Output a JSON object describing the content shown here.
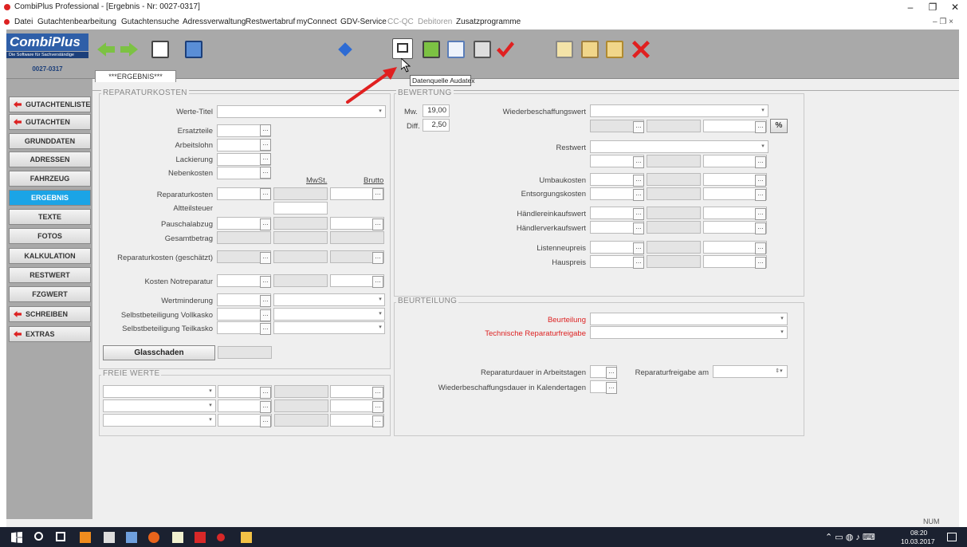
{
  "window": {
    "title": "CombiPlus Professional - [Ergebnis - Nr: 0027-0317]"
  },
  "menu": [
    "Datei",
    "Gutachtenbearbeitung",
    "Gutachtensuche",
    "Adressverwaltung",
    "Restwertabruf",
    "myConnect",
    "GDV-Service",
    "CC-QC",
    "Debitoren",
    "Zusatzprogramme"
  ],
  "logo": {
    "name": "CombiPlus",
    "tagline": "Die Software für Sachverständige",
    "number": "0027-0317"
  },
  "tooltip": "Datenquelle Audatex",
  "nav": [
    "GUTACHTENLISTE",
    "GUTACHTEN",
    "GRUNDDATEN",
    "ADRESSEN",
    "FAHRZEUG",
    "ERGEBNIS",
    "TEXTE",
    "FOTOS",
    "KALKULATION",
    "RESTWERT",
    "FZGWERT",
    "SCHREIBEN",
    "EXTRAS"
  ],
  "tab": "***ERGEBNIS***",
  "rep": {
    "title": "REPARATURKOSTEN",
    "werte_titel": "Werte-Titel",
    "ersatzteile": "Ersatzteile",
    "arbeitslohn": "Arbeitslohn",
    "lackierung": "Lackierung",
    "nebenkosten": "Nebenkosten",
    "mwst": "MwSt.",
    "brutto": "Brutto",
    "reparaturkosten": "Reparaturkosten",
    "altteilsteuer": "Altteilsteuer",
    "pauschalabzug": "Pauschalabzug",
    "gesamtbetrag": "Gesamtbetrag",
    "rep_geschaetzt": "Reparaturkosten (geschätzt)",
    "notreparatur": "Kosten Notreparatur",
    "wertminderung": "Wertminderung",
    "sb_voll": "Selbstbeteiligung Vollkasko",
    "sb_teil": "Selbstbeteiligung Teilkasko",
    "glasschaden": "Glasschaden"
  },
  "freie": {
    "title": "FREIE WERTE"
  },
  "bew": {
    "title": "BEWERTUNG",
    "mw_label": "Mw.",
    "mw_value": "19,00",
    "diff_label": "Diff.",
    "diff_value": "2,50",
    "wiederbeschaffungswert": "Wiederbeschaffungswert",
    "percent": "%",
    "restwert": "Restwert",
    "umbaukosten": "Umbaukosten",
    "entsorgungskosten": "Entsorgungskosten",
    "haendlereinkauf": "Händlereinkaufswert",
    "haendlerverkauf": "Händlerverkaufswert",
    "listenneupreis": "Listenneupreis",
    "hauspreis": "Hauspreis"
  },
  "beu": {
    "title": "BEURTEILUNG",
    "beurteilung": "Beurteilung",
    "technische": "Technische Reparaturfreigabe",
    "dauer_arbeit": "Reparaturdauer in Arbeitstagen",
    "freigabe_am": "Reparaturfreigabe am",
    "dauer_kalender": "Wiederbeschaffungsdauer in Kalendertagen"
  },
  "status": {
    "num": "NUM"
  },
  "taskbar": {
    "time": "08:20",
    "date": "10.03.2017"
  },
  "colors": {
    "accent_nav": "#1ba4e6",
    "red_arrow": "#e02020",
    "toolbar_bg": "#a9a9a9"
  }
}
